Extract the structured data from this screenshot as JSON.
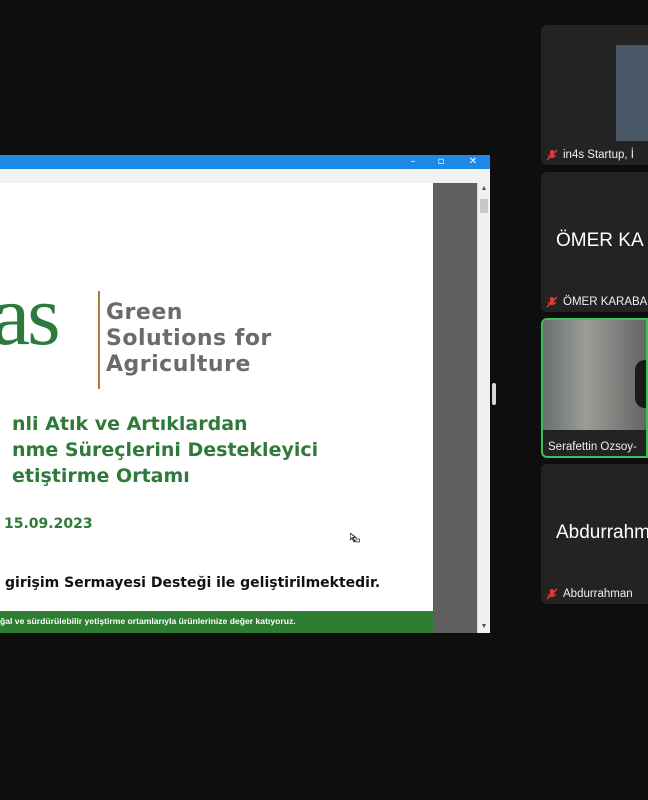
{
  "shared_window": {
    "window_controls": [
      "–",
      "▫",
      "✕"
    ],
    "slide": {
      "logo_letters": "as",
      "logo_tagline": [
        "Green",
        "Solutions for",
        "Agriculture"
      ],
      "headline_lines": [
        "nli Atık ve Artıklardan",
        "nme Süreçlerini Destekleyici",
        "etiştirme Ortamı"
      ],
      "date": "15.09.2023",
      "support_text": "girişim Sermayesi Desteği ile geliştirilmektedir.",
      "footer_text": "ğal ve sürdürülebilir yetiştirme ortamlarıyla ürünlerinize değer katıyoruz."
    }
  },
  "participants": [
    {
      "name": "in4s Startup, İ",
      "muted": true,
      "video": true
    },
    {
      "name": "ÖMER KARABA",
      "big_label": "ÖMER KA",
      "muted": true,
      "video": false
    },
    {
      "name": "Serafettin Ozsoy-",
      "muted": false,
      "video": true,
      "active_speaker": true
    },
    {
      "name": "Abdurrahman",
      "big_label": "Abdurrahm",
      "muted": true,
      "video": false
    }
  ],
  "colors": {
    "title_bar": "#1e88e5",
    "slide_green": "#2e7d32",
    "active_border": "#3fbf5a",
    "muted_icon": "#e53935"
  }
}
